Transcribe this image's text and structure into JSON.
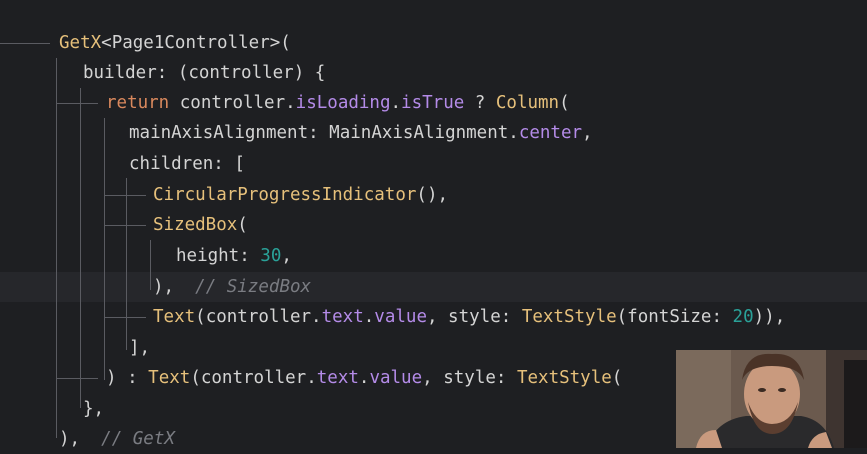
{
  "code": {
    "lines": [
      [
        {
          "t": "GetX",
          "c": "t-cls"
        },
        {
          "t": "<",
          "c": "t-def"
        },
        {
          "t": "Page1Controller",
          "c": "t-def"
        },
        {
          "t": ">(",
          "c": "t-def"
        }
      ],
      [
        {
          "t": "builder: (controller) {",
          "c": "t-def"
        }
      ],
      [
        {
          "t": "return ",
          "c": "t-kw"
        },
        {
          "t": "controller.",
          "c": "t-def"
        },
        {
          "t": "isLoading",
          "c": "t-prop"
        },
        {
          "t": ".",
          "c": "t-def"
        },
        {
          "t": "isTrue",
          "c": "t-prop"
        },
        {
          "t": " ? ",
          "c": "t-def"
        },
        {
          "t": "Column",
          "c": "t-cls"
        },
        {
          "t": "(",
          "c": "t-def"
        }
      ],
      [
        {
          "t": "mainAxisAlignment: MainAxisAlignment.",
          "c": "t-def"
        },
        {
          "t": "center",
          "c": "t-prop"
        },
        {
          "t": ",",
          "c": "t-def"
        }
      ],
      [
        {
          "t": "children: [",
          "c": "t-def"
        }
      ],
      [
        {
          "t": "CircularProgressIndicator",
          "c": "t-cls"
        },
        {
          "t": "(),",
          "c": "t-def"
        }
      ],
      [
        {
          "t": "SizedBox",
          "c": "t-cls"
        },
        {
          "t": "(",
          "c": "t-def"
        }
      ],
      [
        {
          "t": "height: ",
          "c": "t-def"
        },
        {
          "t": "30",
          "c": "t-num"
        },
        {
          "t": ",",
          "c": "t-def"
        }
      ],
      [
        {
          "t": "),  ",
          "c": "t-def"
        },
        {
          "t": "// SizedBox",
          "c": "t-cmt"
        }
      ],
      [
        {
          "t": "Text",
          "c": "t-cls"
        },
        {
          "t": "(controller.",
          "c": "t-def"
        },
        {
          "t": "text",
          "c": "t-prop"
        },
        {
          "t": ".",
          "c": "t-def"
        },
        {
          "t": "value",
          "c": "t-prop"
        },
        {
          "t": ", style: ",
          "c": "t-def"
        },
        {
          "t": "TextStyle",
          "c": "t-cls"
        },
        {
          "t": "(fontSize: ",
          "c": "t-def"
        },
        {
          "t": "20",
          "c": "t-num"
        },
        {
          "t": ")),",
          "c": "t-def"
        }
      ],
      [
        {
          "t": "],",
          "c": "t-def"
        }
      ],
      [
        {
          "t": ") : ",
          "c": "t-def"
        },
        {
          "t": "Text",
          "c": "t-cls"
        },
        {
          "t": "(controller.",
          "c": "t-def"
        },
        {
          "t": "text",
          "c": "t-prop"
        },
        {
          "t": ".",
          "c": "t-def"
        },
        {
          "t": "value",
          "c": "t-prop"
        },
        {
          "t": ", style: ",
          "c": "t-def"
        },
        {
          "t": "TextStyle",
          "c": "t-cls"
        },
        {
          "t": "(",
          "c": "t-def"
        }
      ],
      [
        {
          "t": "},",
          "c": "t-def"
        }
      ],
      [
        {
          "t": "),  ",
          "c": "t-def"
        },
        {
          "t": "// GetX",
          "c": "t-cmt"
        }
      ]
    ]
  },
  "webcam": {
    "label": "presenter webcam"
  }
}
